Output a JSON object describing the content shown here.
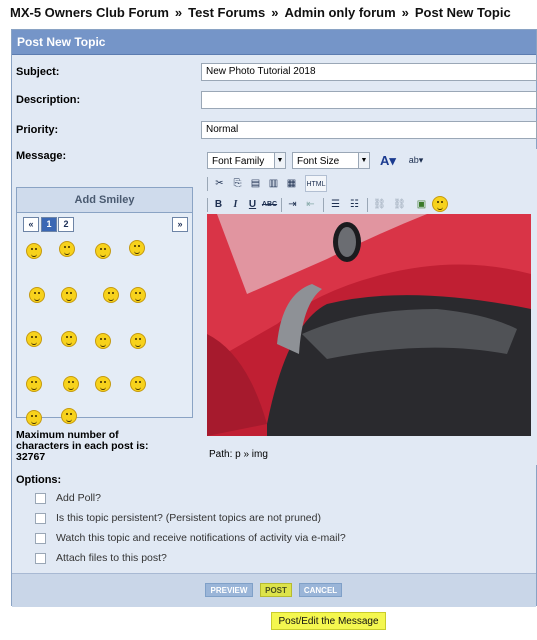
{
  "breadcrumb": {
    "items": [
      "MX-5 Owners Club Forum",
      "Test Forums",
      "Admin only forum",
      "Post New Topic"
    ],
    "separator": "»"
  },
  "panel": {
    "title": "Post New Topic"
  },
  "form": {
    "subject_label": "Subject:",
    "subject_value": "New Photo Tutorial 2018",
    "description_label": "Description:",
    "description_value": "",
    "priority_label": "Priority:",
    "priority_value": "Normal",
    "message_label": "Message:"
  },
  "smiley": {
    "title": "Add Smiley",
    "prev_label": "«",
    "pages": [
      "1",
      "2"
    ],
    "next_label": "»"
  },
  "max_chars": {
    "line1": "Maximum number of",
    "line2": "characters in each post is:",
    "value": "32767"
  },
  "editor": {
    "font_family": "Font Family",
    "font_size": "Font Size",
    "bold": "B",
    "italic": "I",
    "underline": "U",
    "strike": "ABC",
    "html": "HTML",
    "path": "Path: p » img"
  },
  "options": {
    "label": "Options:",
    "items": [
      "Add Poll?",
      "Is this topic persistent? (Persistent topics are not pruned)",
      "Watch this topic and receive notifications of activity via e-mail?",
      "Attach files to this post?"
    ]
  },
  "buttons": {
    "preview": "PREVIEW",
    "post": "POST",
    "cancel": "CANCEL"
  },
  "tooltip": "Post/Edit the Message",
  "colors": {
    "header": "#7595c8",
    "panel": "#e1e9f4",
    "highlight": "#f4f74f"
  }
}
